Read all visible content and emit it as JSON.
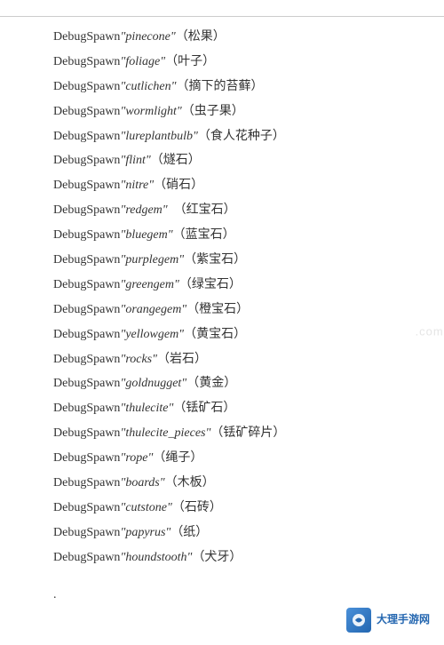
{
  "divider": true,
  "items": [
    {
      "keyword": "DebugSpawn",
      "code": "\"pinecone\"",
      "chinese": "（松果）"
    },
    {
      "keyword": "DebugSpawn",
      "code": "\"foliage\"",
      "chinese": "（叶子）"
    },
    {
      "keyword": "DebugSpawn",
      "code": "\"cutlichen\"",
      "chinese": "（摘下的苔藓）"
    },
    {
      "keyword": "DebugSpawn",
      "code": "\"wormlight\"",
      "chinese": "（虫子果）"
    },
    {
      "keyword": "DebugSpawn",
      "code": "\"lureplantbulb\"",
      "chinese": "（食人花种子）"
    },
    {
      "keyword": "DebugSpawn",
      "code": "\"flint\"",
      "chinese": "（燧石）"
    },
    {
      "keyword": "DebugSpawn",
      "code": "\"nitre\"",
      "chinese": "（硝石）"
    },
    {
      "keyword": "DebugSpawn",
      "code": "\"redgem\"",
      "chinese": "　（红宝石）"
    },
    {
      "keyword": "DebugSpawn",
      "code": "\"bluegem\"",
      "chinese": "（蓝宝石）"
    },
    {
      "keyword": "DebugSpawn",
      "code": "\"purplegem\"",
      "chinese": "（紫宝石）"
    },
    {
      "keyword": "DebugSpawn",
      "code": "\"greengem\"",
      "chinese": "（绿宝石）"
    },
    {
      "keyword": "DebugSpawn",
      "code": "\"orangegem\"",
      "chinese": "（橙宝石）"
    },
    {
      "keyword": "DebugSpawn",
      "code": "\"yellowgem\"",
      "chinese": "（黄宝石）"
    },
    {
      "keyword": "DebugSpawn",
      "code": "\"rocks\"",
      "chinese": "（岩石）"
    },
    {
      "keyword": "DebugSpawn",
      "code": "\"goldnugget\"",
      "chinese": "（黄金）"
    },
    {
      "keyword": "DebugSpawn",
      "code": "\"thulecite\"",
      "chinese": "（铥矿石）"
    },
    {
      "keyword": "DebugSpawn",
      "code": "\"thulecite_pieces\"",
      "chinese": "（铥矿碎片）"
    },
    {
      "keyword": "DebugSpawn",
      "code": "\"rope\"",
      "chinese": "（绳子）"
    },
    {
      "keyword": "DebugSpawn",
      "code": "\"boards\"",
      "chinese": "（木板）"
    },
    {
      "keyword": "DebugSpawn",
      "code": "\"cutstone\"",
      "chinese": "（石砖）"
    },
    {
      "keyword": "DebugSpawn",
      "code": "\"papyrus\"",
      "chinese": "（纸）"
    },
    {
      "keyword": "DebugSpawn",
      "code": "\"houndstooth\"",
      "chinese": "（犬牙）"
    }
  ],
  "dot": ".",
  "watermark": ".com",
  "logo": {
    "site_name": "大理手游网",
    "sub_text": ""
  }
}
